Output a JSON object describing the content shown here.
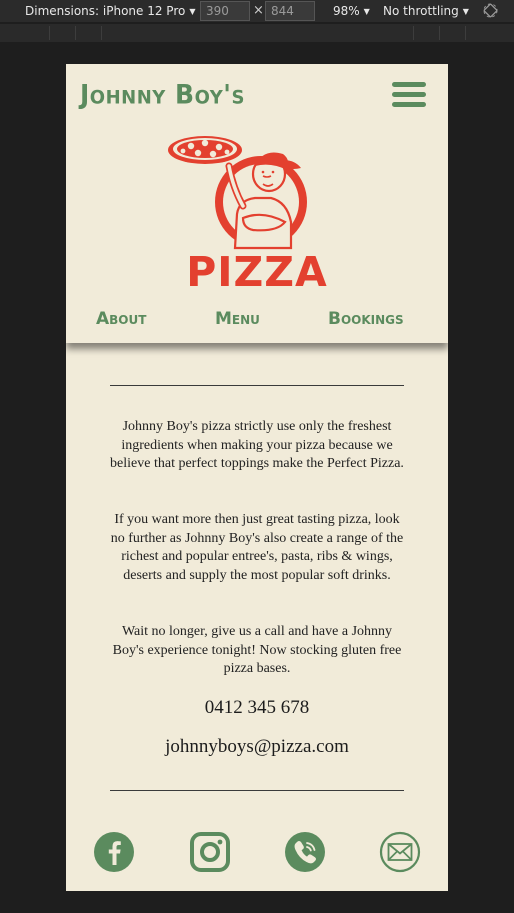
{
  "devtools": {
    "device_label": "Dimensions: iPhone 12 Pro",
    "width_value": "390",
    "height_value": "844",
    "times": "×",
    "zoom": "98%",
    "throttle": "No throttling"
  },
  "header": {
    "brand": "Johnny Boy's",
    "logo_word": "PIZZA",
    "nav": [
      "About",
      "Menu",
      "Bookings"
    ]
  },
  "content": {
    "paragraphs": [
      "Johnny Boy's pizza strictly use only the freshest ingredients when making your pizza because we believe that perfect toppings make the Perfect Pizza.",
      "If you want more then just great tasting pizza, look no further as Johnny Boy's also create a range of the richest and popular entree's, pasta, ribs & wings, deserts and supply the most popular soft drinks.",
      "Wait no longer, give us a call and have a Johnny Boy's experience tonight! Now stocking gluten free pizza bases."
    ],
    "phone": "0412 345 678",
    "email": "johnnyboys@pizza.com"
  },
  "socials": [
    "facebook-icon",
    "instagram-icon",
    "phone-icon",
    "mail-icon"
  ],
  "colors": {
    "page_bg": "#f1ebd9",
    "brand_green": "#5b8b5e",
    "logo_red": "#e3402f"
  }
}
